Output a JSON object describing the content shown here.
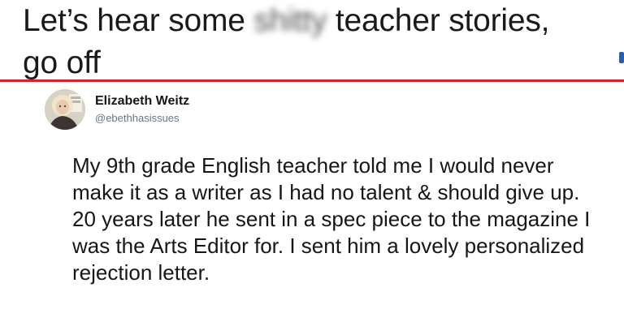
{
  "headline": {
    "before": "Let’s hear some ",
    "blurred_word": "shitty",
    "after_line1": " teacher stories,",
    "line2": "go off"
  },
  "tweet": {
    "author_name": "Elizabeth Weitz",
    "author_handle": "@ebethhasissues",
    "text": "My 9th grade English teacher told me I would never make it as a writer as I had no talent & should give up. 20 years later he sent in a spec piece to the magazine I was the Arts Editor for. I sent him a lovely personalized rejection letter."
  },
  "colors": {
    "rule": "#d1242b",
    "text": "#1a1a1a",
    "handle": "#657786"
  }
}
